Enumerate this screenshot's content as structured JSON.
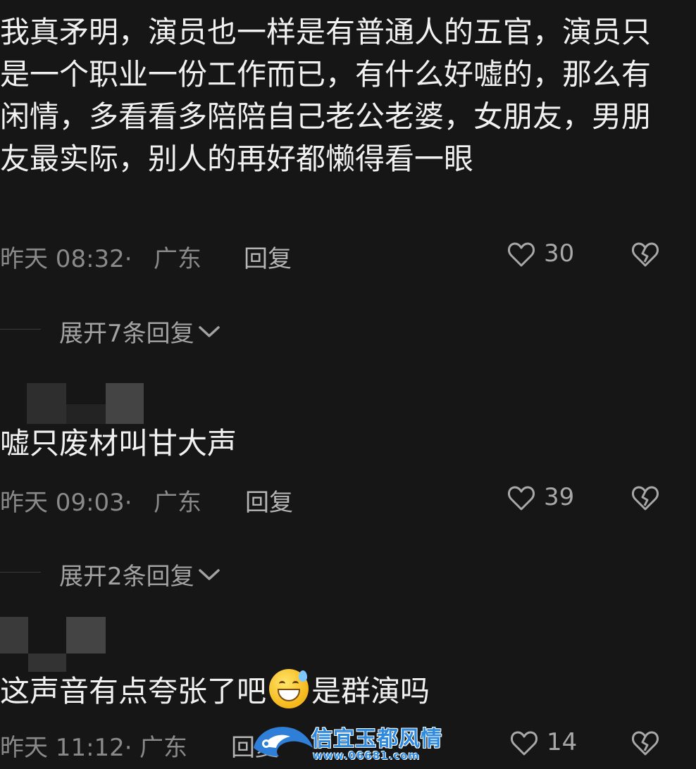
{
  "comments": [
    {
      "text": "我真矛明，演员也一样是有普通人的五官，演员只是一个职业一份工作而已，有什么好嘘的，那么有闲情，多看看多陪陪自己老公老婆，女朋友，男朋友最实际，别人的再好都懒得看一眼",
      "time": "昨天 08:32·",
      "location": "广东",
      "reply_label": "回复",
      "likes": "30",
      "expand_label": "展开7条回复"
    },
    {
      "text": "嘘只废材叫甘大声",
      "time": "昨天 09:03·",
      "location": "广东",
      "reply_label": "回复",
      "likes": "39",
      "expand_label": "展开2条回复"
    },
    {
      "text_before": "这声音有点夸张了吧",
      "emoji": "grinning-sweat-emoji",
      "text_after": "是群演吗",
      "time": "昨天 11:12·",
      "location": "广东",
      "reply_label": "回复",
      "likes": "14"
    }
  ],
  "watermark": {
    "title": "信宜玉都风情",
    "url": "www.06681.com"
  },
  "colors": {
    "background": "#161616",
    "text": "#f1f1f1",
    "meta": "#8a8a8a",
    "icon": "#a8a8a8"
  },
  "icons": {
    "like": "heart-outline-icon",
    "dislike": "broken-heart-icon",
    "expand": "chevron-down-icon"
  }
}
